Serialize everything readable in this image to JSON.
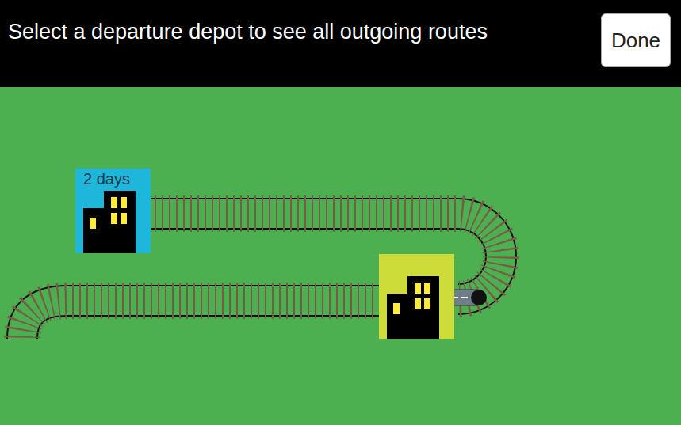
{
  "header": {
    "instruction": "Select a departure depot to see all outgoing routes",
    "done_button": "Done"
  },
  "depots": [
    {
      "label": "2 days",
      "color": "#1fb6dc"
    },
    {
      "color": "#cddc39"
    }
  ]
}
